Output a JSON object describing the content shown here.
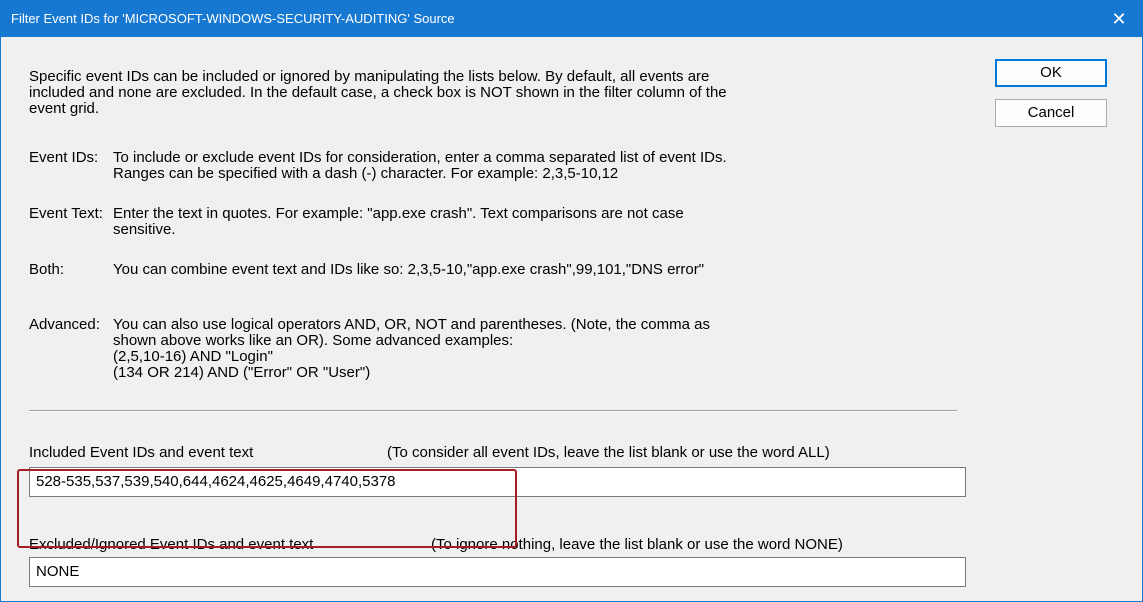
{
  "window": {
    "title": "Filter Event IDs for 'MICROSOFT-WINDOWS-SECURITY-AUDITING' Source",
    "close_glyph": "✕"
  },
  "buttons": {
    "ok_label": "OK",
    "cancel_label": "Cancel"
  },
  "intro": [
    "Specific event IDs can be included or ignored by manipulating the lists below.  By default, all events are",
    "included and none are excluded.  In the default case, a check box is NOT shown in the filter column of the",
    "event grid."
  ],
  "help": {
    "event_ids": {
      "label": "Event IDs:",
      "lines": [
        "To include or exclude event IDs for consideration, enter a comma separated list of event IDs.",
        "Ranges can be specified with a dash (-) character.  For example: 2,3,5-10,12"
      ]
    },
    "event_text": {
      "label": "Event Text:",
      "lines": [
        "Enter the text in quotes.  For example: \"app.exe crash\".   Text comparisons are not case",
        "sensitive."
      ]
    },
    "both": {
      "label": "Both:",
      "lines": [
        "You can combine event text and IDs like so: 2,3,5-10,\"app.exe crash\",99,101,\"DNS error\""
      ]
    },
    "advanced": {
      "label": "Advanced:",
      "lines": [
        "You can also use logical operators AND, OR, NOT and parentheses.  (Note, the comma as",
        "shown above works like an OR).  Some advanced examples:",
        "(2,5,10-16) AND \"Login\"",
        "(134 OR 214) AND (\"Error\" OR \"User\")"
      ]
    }
  },
  "included": {
    "label": "Included Event IDs and event text",
    "hint": "(To consider all event IDs, leave the list blank or use the word ALL)",
    "value": "528-535,537,539,540,644,4624,4625,4649,4740,5378"
  },
  "excluded": {
    "label": "Excluded/Ignored Event IDs and event text",
    "hint": "(To ignore nothing, leave the list blank or use the word NONE)",
    "value": "NONE"
  },
  "colors": {
    "titlebar": "#1778d2",
    "client_bg": "#f0f0f0",
    "highlight_border": "#a51e22"
  }
}
